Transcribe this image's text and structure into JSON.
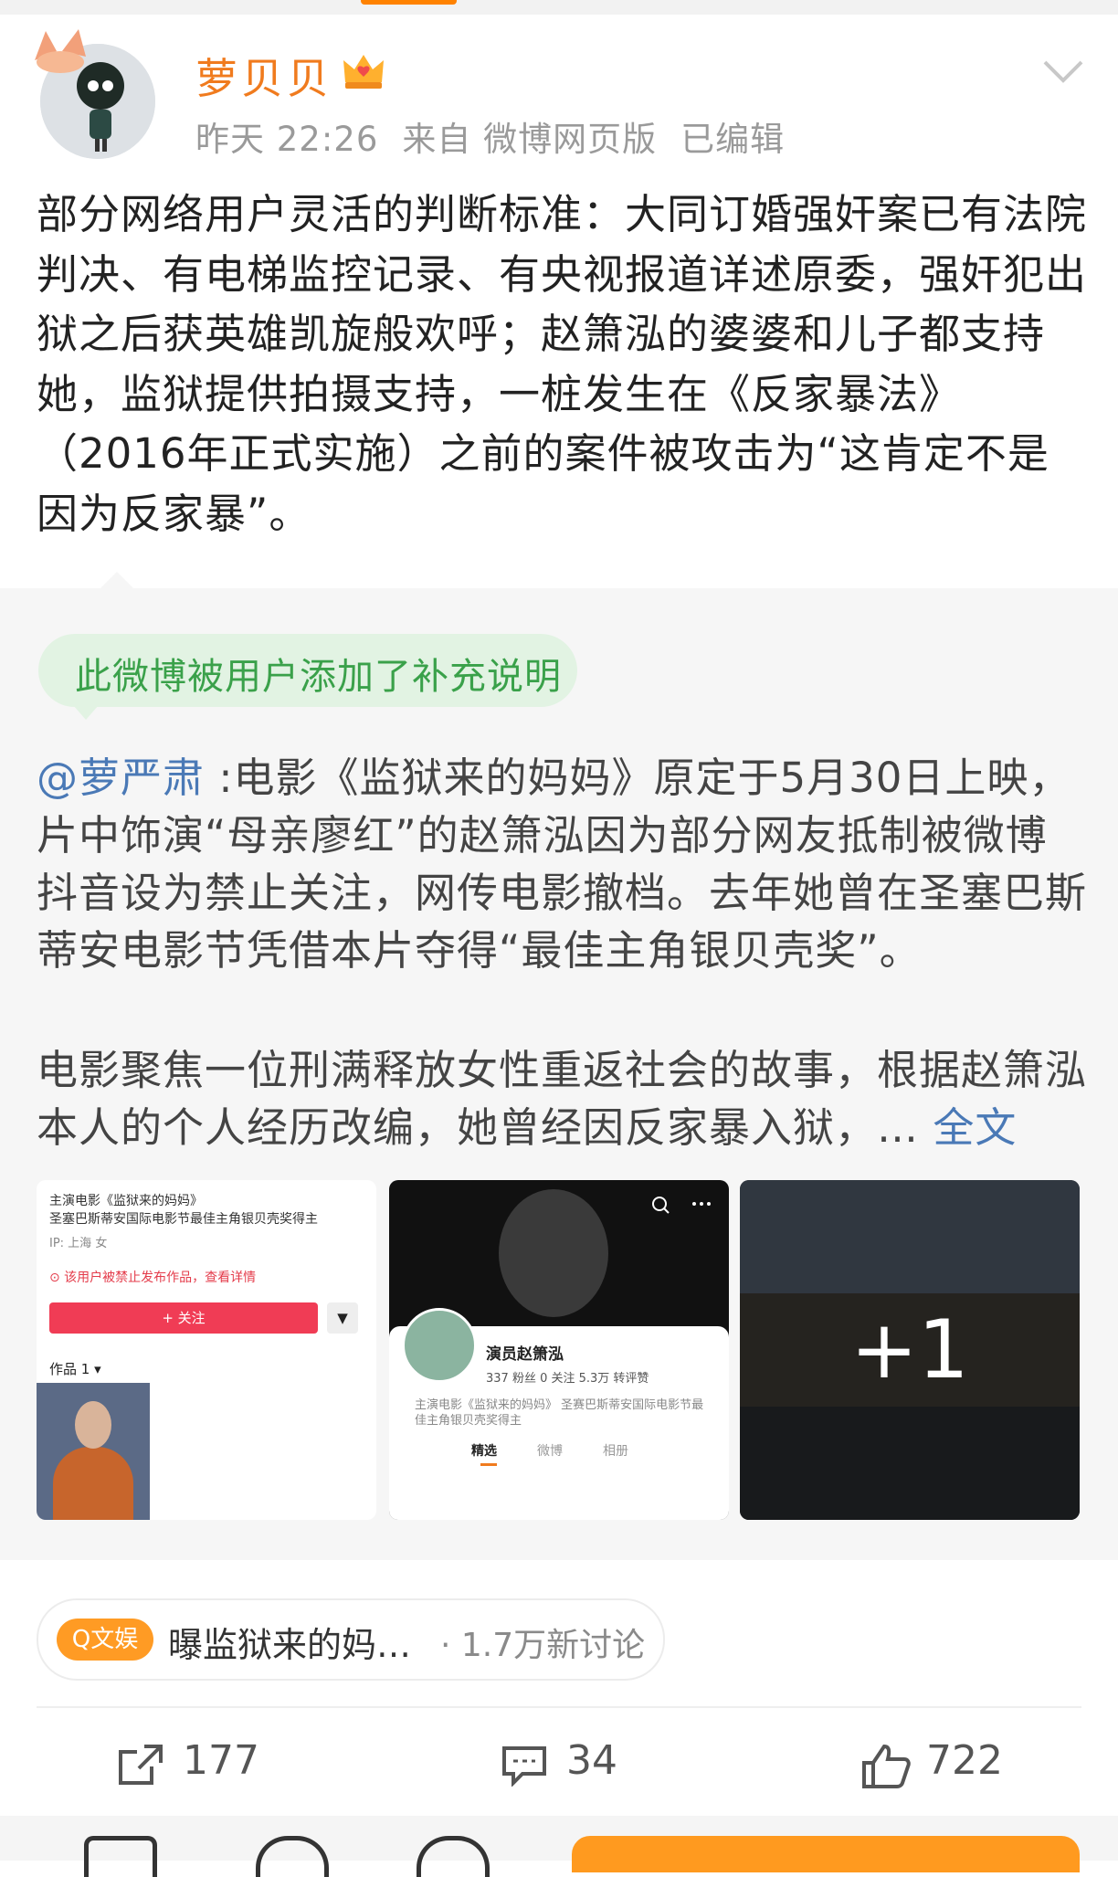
{
  "post": {
    "username": "萝贝贝",
    "time": "昨天 22:26",
    "source": "来自 微博网页版",
    "edited": "已编辑",
    "body": "部分网络用户灵活的判断标准：大同订婚强奸案已有法院判决、有电梯监控记录、有央视报道详述原委，强奸犯出狱之后获英雄凯旋般欢呼；赵箫泓的婆婆和儿子都支持她，监狱提供拍摄支持，一桩发生在《反家暴法》（2016年正式实施）之前的案件被攻击为“这肯定不是因为反家暴”。"
  },
  "supplement": {
    "badge": "此微博被用户添加了补充说明",
    "mention": "@萝严肃",
    "text1": " :电影《监狱来的妈妈》原定于5月30日上映，片中饰演“母亲廖红”的赵箫泓因为部分网友抵制被微博抖音设为禁止关注，网传电影撤档。去年她曾在圣塞巴斯蒂安电影节凭借本片夺得“最佳主角银贝壳奖”。",
    "text2": "电影聚焦一位刑满释放女性重返社会的故事，根据赵箫泓本人的个人经历改编，她曾经因反家暴入狱，… ",
    "more": "全文"
  },
  "images": {
    "img1": {
      "line1": "主演电影《监狱来的妈妈》",
      "line2": "圣塞巴斯蒂安国际电影节最佳主角银贝壳奖得主",
      "ip": "IP: 上海    女",
      "warning": "⊙ 该用户被禁止发布作品，查看详情",
      "follow": "+ 关注",
      "works": "作品 1 ▾"
    },
    "img2": {
      "name": "演员赵箫泓",
      "stats": "337 粉丝    0 关注    5.3万 转评赞",
      "desc": "主演电影《监狱来的妈妈》 圣赛巴斯蒂安国际电影节最佳主角银贝壳奖得主",
      "tab1": "精选",
      "tab2": "微博",
      "tab3": "相册"
    },
    "img3": {
      "more_count": "+1"
    }
  },
  "topic": {
    "tag": "Q文娱",
    "title": "曝监狱来的妈…",
    "count": "· 1.7万新讨论"
  },
  "actions": {
    "repost": "177",
    "comment": "34",
    "like": "722"
  },
  "colors": {
    "username": "#f07b1e",
    "link": "#4a79b6",
    "badge_text": "#3aa14a",
    "badge_bg": "#e2f3e3",
    "topic_tag": "#ff9b24"
  }
}
